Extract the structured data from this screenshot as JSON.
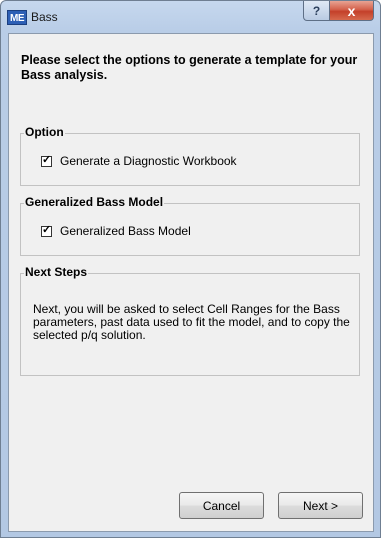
{
  "window": {
    "title": "Bass",
    "app_icon_text": "ME",
    "help_glyph": "?",
    "close_glyph": "x"
  },
  "heading": "Please select the options to generate a template for your Bass analysis.",
  "option_group": {
    "title": "Option",
    "checkbox_label": "Generate a Diagnostic Workbook",
    "checked": true
  },
  "bass_group": {
    "title": "Generalized Bass Model",
    "checkbox_label": "Generalized Bass Model",
    "checked": true
  },
  "next_steps": {
    "title": "Next Steps",
    "text": "Next, you will be asked to select Cell Ranges for the Bass parameters, past data used to fit the model, and to copy the selected p/q solution."
  },
  "buttons": {
    "cancel_label": "Cancel",
    "next_label": "Next >"
  },
  "check_glyph": "✓"
}
